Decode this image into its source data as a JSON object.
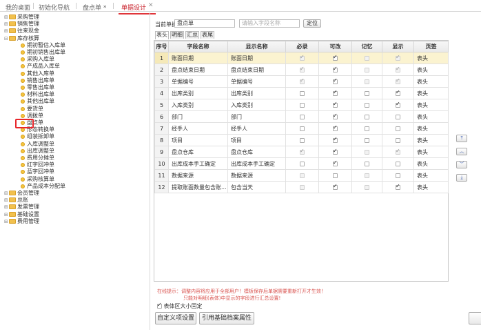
{
  "top_tabs": {
    "desktop": "我的桌面",
    "init_nav": "初始化导航",
    "stocktake_doc": "盘点单 *",
    "doc_design": "单据设计"
  },
  "tree": {
    "nodes": [
      {
        "label": "采购管理",
        "type": "folder",
        "toggle": "+"
      },
      {
        "label": "销售管理",
        "type": "folder",
        "toggle": "+"
      },
      {
        "label": "往来现金",
        "type": "folder",
        "toggle": "+"
      },
      {
        "label": "库存核算",
        "type": "folder",
        "toggle": "-"
      },
      {
        "label": "期初暂估入库单",
        "type": "leaf"
      },
      {
        "label": "期初销售出库单",
        "type": "leaf"
      },
      {
        "label": "采购入库单",
        "type": "leaf"
      },
      {
        "label": "产成品入库单",
        "type": "leaf"
      },
      {
        "label": "其他入库单",
        "type": "leaf"
      },
      {
        "label": "销售出库单",
        "type": "leaf"
      },
      {
        "label": "零售出库单",
        "type": "leaf"
      },
      {
        "label": "材料出库单",
        "type": "leaf"
      },
      {
        "label": "其他出库单",
        "type": "leaf"
      },
      {
        "label": "要货单",
        "type": "leaf"
      },
      {
        "label": "调拨单",
        "type": "leaf"
      },
      {
        "label": "盘点单",
        "type": "leaf"
      },
      {
        "label": "形态转换单",
        "type": "leaf"
      },
      {
        "label": "组装拆卸单",
        "type": "leaf"
      },
      {
        "label": "入库调整单",
        "type": "leaf"
      },
      {
        "label": "出库调整单",
        "type": "leaf"
      },
      {
        "label": "费用分摊单",
        "type": "leaf"
      },
      {
        "label": "红字回冲单",
        "type": "leaf"
      },
      {
        "label": "蓝字回冲单",
        "type": "leaf"
      },
      {
        "label": "采购核算单",
        "type": "leaf"
      },
      {
        "label": "产品成本分配单",
        "type": "leaf"
      },
      {
        "label": "会员管理",
        "type": "folder",
        "toggle": "+"
      },
      {
        "label": "总账",
        "type": "folder",
        "toggle": "+"
      },
      {
        "label": "发票管理",
        "type": "folder",
        "toggle": "+"
      },
      {
        "label": "基础设置",
        "type": "folder",
        "toggle": "+"
      },
      {
        "label": "费用管理",
        "type": "folder",
        "toggle": "+"
      }
    ]
  },
  "form": {
    "current_doc_label": "当前单据",
    "current_doc_value": "盘点单",
    "search_placeholder": "请输入字段名称",
    "locate_button": "定位"
  },
  "sub_tabs": [
    "表头",
    "明细",
    "汇总",
    "表尾"
  ],
  "grid": {
    "headers": [
      "序号",
      "字段名称",
      "显示名称",
      "必录",
      "可改",
      "记忆",
      "显示",
      "页签"
    ],
    "rows": [
      {
        "no": "1",
        "field": "账面日期",
        "display": "账面日期",
        "required": true,
        "req_dis": true,
        "editable": true,
        "memory": false,
        "mem_dis": true,
        "show": true,
        "show_dis": true,
        "tab": "表头"
      },
      {
        "no": "2",
        "field": "盘点结束日期",
        "display": "盘点结束日期",
        "required": true,
        "req_dis": true,
        "editable": true,
        "memory": false,
        "mem_dis": true,
        "show": true,
        "show_dis": true,
        "tab": "表头"
      },
      {
        "no": "3",
        "field": "单据编号",
        "display": "单据编号",
        "required": true,
        "req_dis": true,
        "editable": true,
        "memory": false,
        "mem_dis": true,
        "show": true,
        "show_dis": true,
        "tab": "表头"
      },
      {
        "no": "4",
        "field": "出库类别",
        "display": "出库类别",
        "required": false,
        "req_dis": false,
        "editable": true,
        "memory": false,
        "mem_dis": false,
        "show": true,
        "show_dis": false,
        "tab": "表头"
      },
      {
        "no": "5",
        "field": "入库类别",
        "display": "入库类别",
        "required": false,
        "req_dis": false,
        "editable": true,
        "memory": false,
        "mem_dis": false,
        "show": true,
        "show_dis": false,
        "tab": "表头"
      },
      {
        "no": "6",
        "field": "部门",
        "display": "部门",
        "required": false,
        "req_dis": false,
        "editable": true,
        "memory": false,
        "mem_dis": false,
        "show": false,
        "show_dis": false,
        "tab": "表头"
      },
      {
        "no": "7",
        "field": "经手人",
        "display": "经手人",
        "required": false,
        "req_dis": false,
        "editable": true,
        "memory": false,
        "mem_dis": false,
        "show": false,
        "show_dis": false,
        "tab": "表头"
      },
      {
        "no": "8",
        "field": "项目",
        "display": "项目",
        "required": false,
        "req_dis": false,
        "editable": true,
        "memory": false,
        "mem_dis": false,
        "show": false,
        "show_dis": false,
        "tab": "表头"
      },
      {
        "no": "9",
        "field": "盘点仓库",
        "display": "盘点仓库",
        "required": true,
        "req_dis": true,
        "editable": true,
        "memory": false,
        "mem_dis": true,
        "show": true,
        "show_dis": true,
        "tab": "表头"
      },
      {
        "no": "10",
        "field": "出库成本手工确定",
        "display": "出库成本手工确定",
        "required": false,
        "req_dis": false,
        "editable": true,
        "memory": false,
        "mem_dis": false,
        "show": false,
        "show_dis": false,
        "tab": "表头"
      },
      {
        "no": "11",
        "field": "数据来源",
        "display": "数据来源",
        "required": false,
        "req_dis": true,
        "editable": false,
        "memory": false,
        "mem_dis": true,
        "show": false,
        "show_dis": false,
        "tab": "表头"
      },
      {
        "no": "12",
        "field": "提取账面数量包含账...",
        "display": "包含当天",
        "required": false,
        "req_dis": true,
        "editable": true,
        "memory": false,
        "mem_dis": true,
        "show": true,
        "show_dis": false,
        "tab": "表头"
      }
    ]
  },
  "move_buttons": [
    "top",
    "up",
    "down",
    "bottom"
  ],
  "hint": {
    "line1": "在线提示：调整内容将应用于全部用户！模板保存后单据需要重新打开才生效！",
    "line2": "只能对明细(表体)中显示的字段进行汇总设置!"
  },
  "footer": {
    "fixed_size_label": "表体区大小固定",
    "custom_button": "自定义项设置",
    "ref_button": "引用基础档案属性"
  }
}
